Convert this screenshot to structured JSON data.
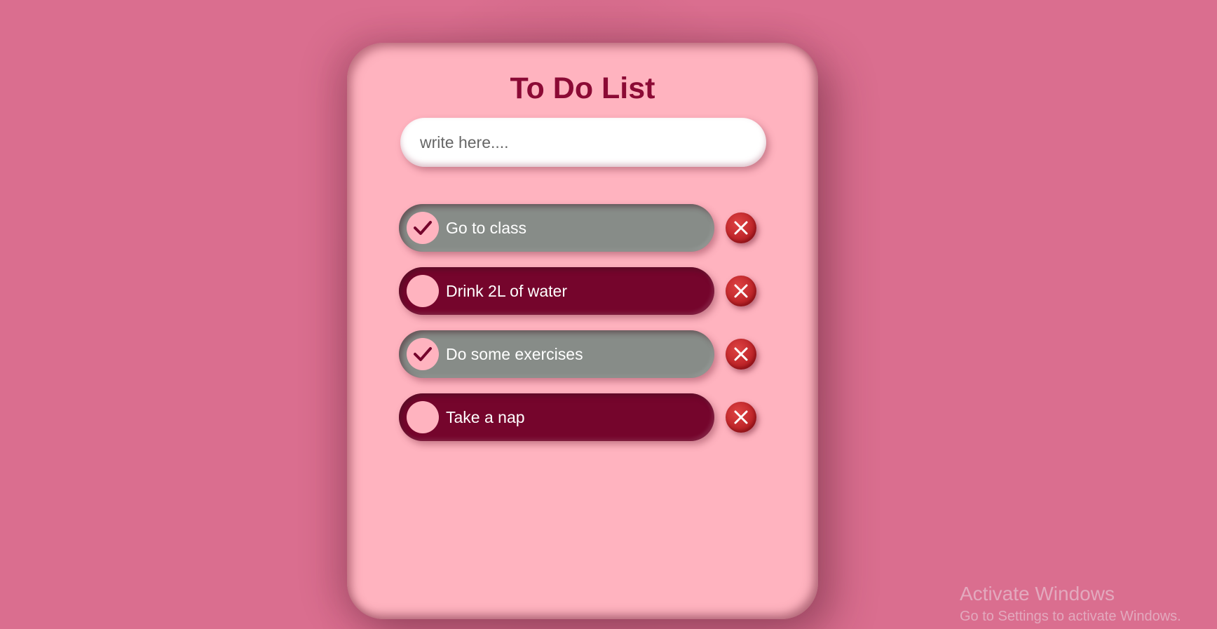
{
  "app": {
    "title": "To Do List"
  },
  "input": {
    "placeholder": "write here....",
    "value": ""
  },
  "tasks": [
    {
      "text": "Go to class",
      "completed": true
    },
    {
      "text": "Drink 2L of water",
      "completed": false
    },
    {
      "text": "Do some exercises",
      "completed": true
    },
    {
      "text": "Take a nap",
      "completed": false
    }
  ],
  "icons": {
    "check": "checkmark-icon",
    "delete": "close-icon"
  },
  "colors": {
    "background": "#da6e8f",
    "card": "#ffb3bf",
    "title": "#8b0a35",
    "task_pending": "#75052c",
    "task_done": "#878c88",
    "delete_button": "#c62b2e"
  },
  "watermark": {
    "title": "Activate Windows",
    "subtitle": "Go to Settings to activate Windows."
  }
}
